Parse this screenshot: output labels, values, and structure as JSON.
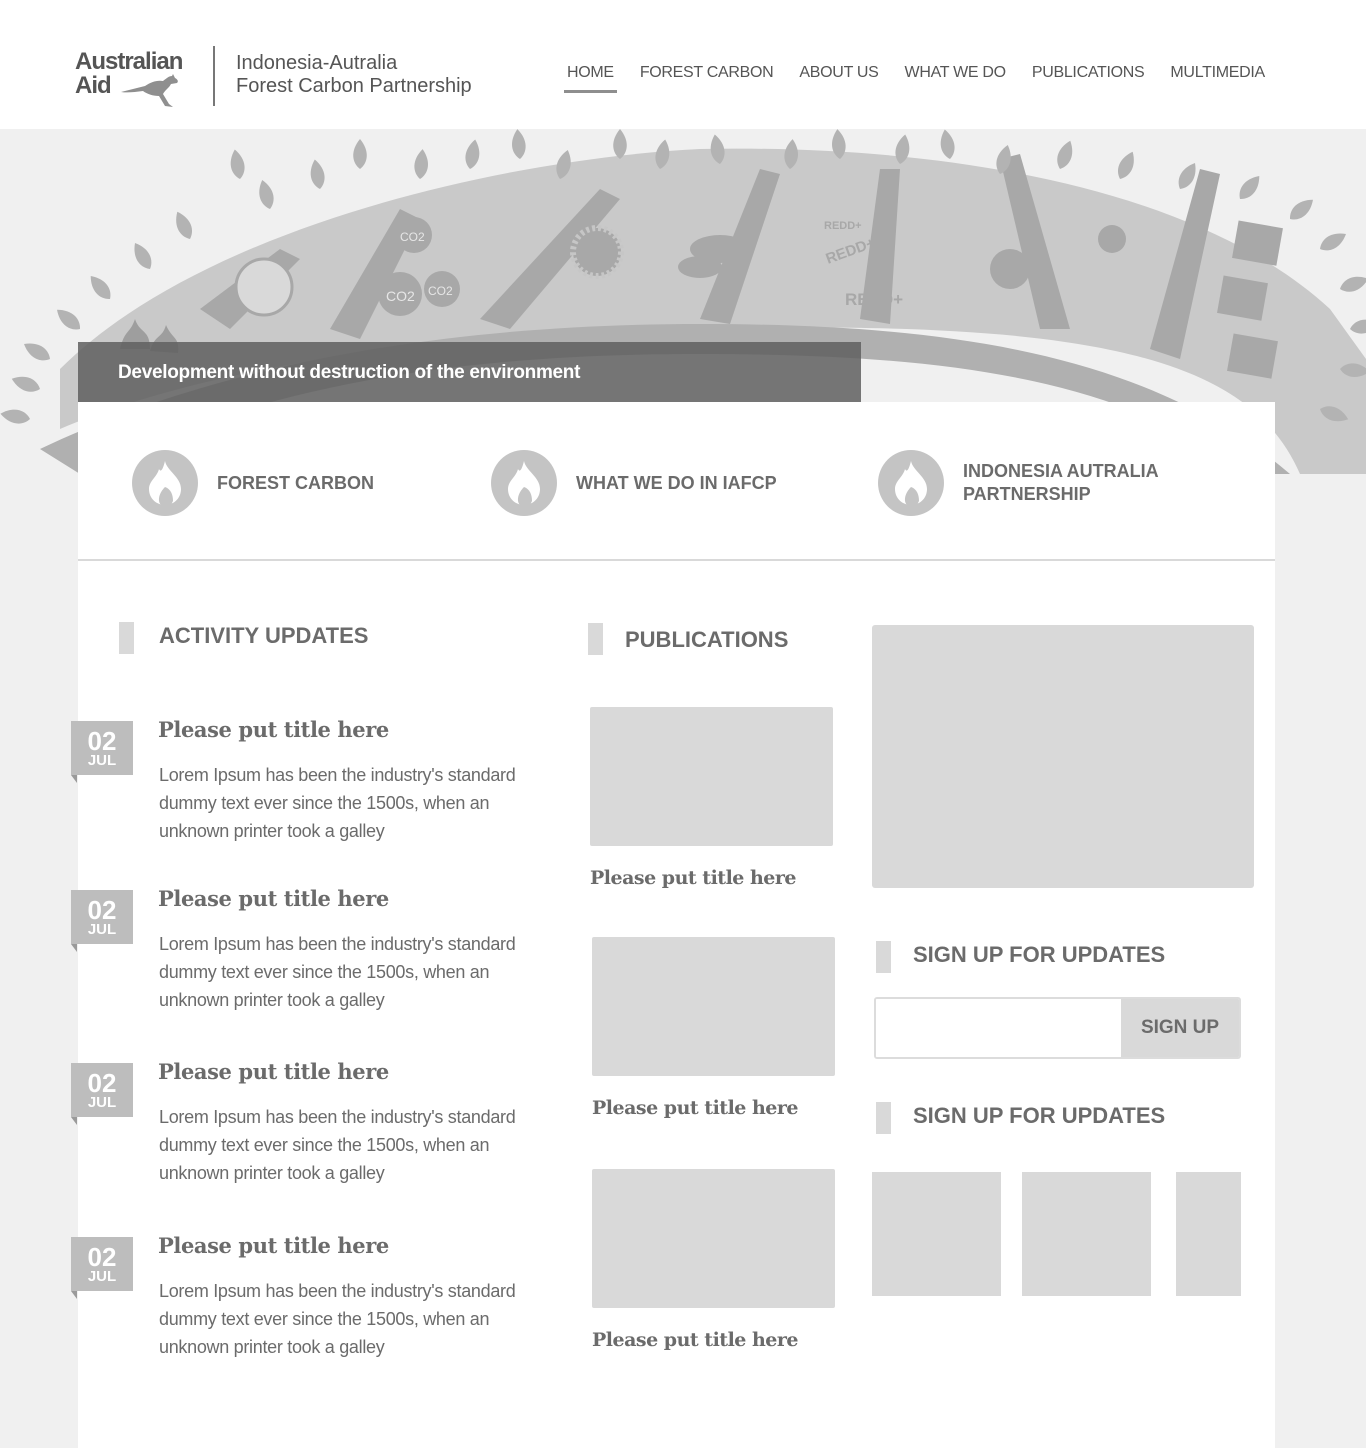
{
  "header": {
    "logo": {
      "line1": "Australian",
      "line2": "Aid"
    },
    "site_title_line1": "Indonesia-Autralia",
    "site_title_line2": "Forest Carbon Partnership",
    "nav": [
      {
        "label": "HOME",
        "active": true
      },
      {
        "label": "FOREST CARBON",
        "active": false
      },
      {
        "label": "ABOUT US",
        "active": false
      },
      {
        "label": "WHAT WE DO",
        "active": false
      },
      {
        "label": "PUBLICATIONS",
        "active": false
      },
      {
        "label": "MULTIMEDIA",
        "active": false
      }
    ]
  },
  "hero": {
    "tagline": "Development without destruction of the environment",
    "artwork_labels": [
      "CO2",
      "CO2",
      "CO2",
      "REDD+",
      "REDD+",
      "REDD+"
    ]
  },
  "features": [
    {
      "label": "FOREST CARBON",
      "icon": "flame-icon"
    },
    {
      "label": "WHAT WE DO IN IAFCP",
      "icon": "flame-icon"
    },
    {
      "label_line1": "INDONESIA AUTRALIA",
      "label_line2": "PARTNERSHIP",
      "icon": "flame-icon"
    }
  ],
  "activity_updates": {
    "title": "ACTIVITY UPDATES",
    "items": [
      {
        "day": "02",
        "month": "JUL",
        "title": "Please put title here",
        "body": "Lorem Ipsum has been the industry's standard dummy text ever since the 1500s, when an unknown printer took a galley"
      },
      {
        "day": "02",
        "month": "JUL",
        "title": "Please put title here",
        "body": "Lorem Ipsum has been the industry's standard dummy text ever since the 1500s, when an unknown printer took a galley"
      },
      {
        "day": "02",
        "month": "JUL",
        "title": "Please put title here",
        "body": "Lorem Ipsum has been the industry's standard dummy text ever since the 1500s, when an unknown printer took a galley"
      },
      {
        "day": "02",
        "month": "JUL",
        "title": "Please put title here",
        "body": "Lorem Ipsum has been the industry's standard dummy text ever since the 1500s, when an unknown printer took a galley"
      }
    ]
  },
  "publications": {
    "title": "PUBLICATIONS",
    "items": [
      {
        "title": "Please put title here"
      },
      {
        "title": "Please put title here"
      },
      {
        "title": "Please put title here"
      }
    ]
  },
  "sidebar": {
    "signup_title": "SIGN UP FOR UPDATES",
    "email_value": "",
    "email_placeholder": "",
    "signup_button": "SIGN UP",
    "second_title": "SIGN UP FOR UPDATES"
  },
  "colors": {
    "text": "#6b6b6b",
    "placeholder_gray": "#d9d9d9",
    "badge_gray": "#bdbdbd",
    "banner": "#6e6e6e",
    "background": "#f0f0f0"
  }
}
